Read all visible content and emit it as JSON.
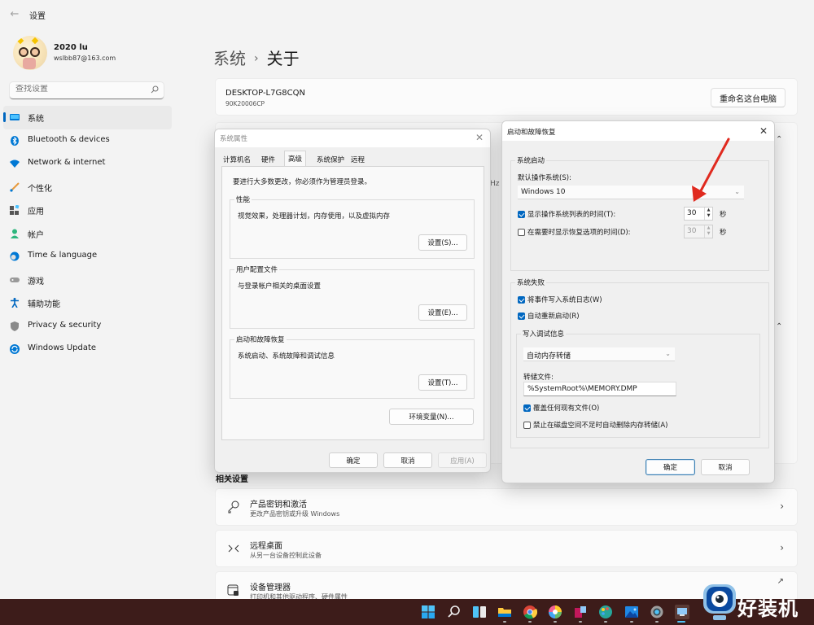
{
  "window": {
    "title": "设置",
    "back_icon": "back-arrow-icon"
  },
  "profile": {
    "name": "2020 lu",
    "email": "wslbb87@163.com"
  },
  "search": {
    "placeholder": "查找设置",
    "value": ""
  },
  "sidebar": {
    "items": [
      {
        "label": "系统",
        "icon": "system-icon",
        "active": true
      },
      {
        "label": "Bluetooth & devices",
        "icon": "bluetooth-icon"
      },
      {
        "label": "Network & internet",
        "icon": "wifi-icon"
      },
      {
        "label": "个性化",
        "icon": "brush-icon"
      },
      {
        "label": "应用",
        "icon": "apps-icon"
      },
      {
        "label": "帐户",
        "icon": "account-icon"
      },
      {
        "label": "Time & language",
        "icon": "globe-clock-icon"
      },
      {
        "label": "游戏",
        "icon": "gamepad-icon"
      },
      {
        "label": "辅助功能",
        "icon": "accessibility-icon"
      },
      {
        "label": "Privacy & security",
        "icon": "shield-icon"
      },
      {
        "label": "Windows Update",
        "icon": "update-icon"
      }
    ]
  },
  "main": {
    "breadcrumb": {
      "parent": "系统",
      "separator": "›",
      "current": "关于"
    },
    "device": {
      "name": "DESKTOP-L7G8CQN",
      "model": "90K20006CP",
      "rename_label": "重命名这台电脑"
    },
    "background_hz": "Hz",
    "related": {
      "title": "相关设置",
      "items": [
        {
          "title": "产品密钥和激活",
          "subtitle": "更改产品密钥或升级 Windows",
          "icon": "key-icon",
          "action": "chevron-right-icon"
        },
        {
          "title": "远程桌面",
          "subtitle": "从另一台设备控制此设备",
          "icon": "remote-desktop-icon",
          "action": "chevron-right-icon"
        },
        {
          "title": "设备管理器",
          "subtitle": "打印机和其他驱动程序、硬件属性",
          "icon": "device-manager-icon",
          "action": "external-link-icon"
        }
      ]
    }
  },
  "system_properties": {
    "title": "系统属性",
    "tabs": [
      {
        "label": "计算机名"
      },
      {
        "label": "硬件"
      },
      {
        "label": "高级",
        "active": true
      },
      {
        "label": "系统保护"
      },
      {
        "label": "远程"
      }
    ],
    "admin_note": "要进行大多数更改，你必须作为管理员登录。",
    "groups": [
      {
        "legend": "性能",
        "desc": "视觉效果，处理器计划，内存使用，以及虚拟内存",
        "button": "设置(S)..."
      },
      {
        "legend": "用户配置文件",
        "desc": "与登录帐户相关的桌面设置",
        "button": "设置(E)..."
      },
      {
        "legend": "启动和故障恢复",
        "desc": "系统启动、系统故障和调试信息",
        "button": "设置(T)..."
      }
    ],
    "env_button": "环境变量(N)...",
    "ok": "确定",
    "cancel": "取消",
    "apply": "应用(A)"
  },
  "startup_recovery": {
    "title": "启动和故障恢复",
    "startup_group": {
      "legend": "系统启动",
      "default_os_label": "默认操作系统(S):",
      "default_os_value": "Windows 10",
      "show_os_list": {
        "label": "显示操作系统列表的时间(T):",
        "checked": true,
        "value": "30",
        "unit": "秒"
      },
      "show_recovery": {
        "label": "在需要时显示恢复选项的时间(D):",
        "checked": false,
        "value": "30",
        "unit": "秒"
      }
    },
    "failure_group": {
      "legend": "系统失败",
      "write_event": {
        "label": "将事件写入系统日志(W)",
        "checked": true
      },
      "auto_restart": {
        "label": "自动重新启动(R)",
        "checked": true
      },
      "debug_group": {
        "legend": "写入调试信息",
        "dump_type": "自动内存转储",
        "dump_file_label": "转储文件:",
        "dump_file_value": "%SystemRoot%\\MEMORY.DMP",
        "overwrite": {
          "label": "覆盖任何现有文件(O)",
          "checked": true
        },
        "disable_auto_delete": {
          "label": "禁止在磁盘空间不足时自动删除内存转储(A)",
          "checked": false
        }
      }
    },
    "ok": "确定",
    "cancel": "取消"
  },
  "annotation": {
    "type": "red-arrow",
    "color": "#e02a1f"
  },
  "taskbar": {
    "items": [
      {
        "name": "start-icon"
      },
      {
        "name": "search-icon"
      },
      {
        "name": "widgets-icon"
      },
      {
        "name": "file-explorer-icon"
      },
      {
        "name": "chrome-icon"
      },
      {
        "name": "color-app-icon"
      },
      {
        "name": "app-red-icon"
      },
      {
        "name": "paint-icon"
      },
      {
        "name": "photos-icon"
      },
      {
        "name": "settings-icon"
      },
      {
        "name": "system-properties-icon"
      }
    ]
  },
  "watermark": {
    "text": "好装机"
  },
  "colors": {
    "accent": "#0067c0",
    "taskbar": "#3d1c1a",
    "arrow": "#e02a1f"
  }
}
